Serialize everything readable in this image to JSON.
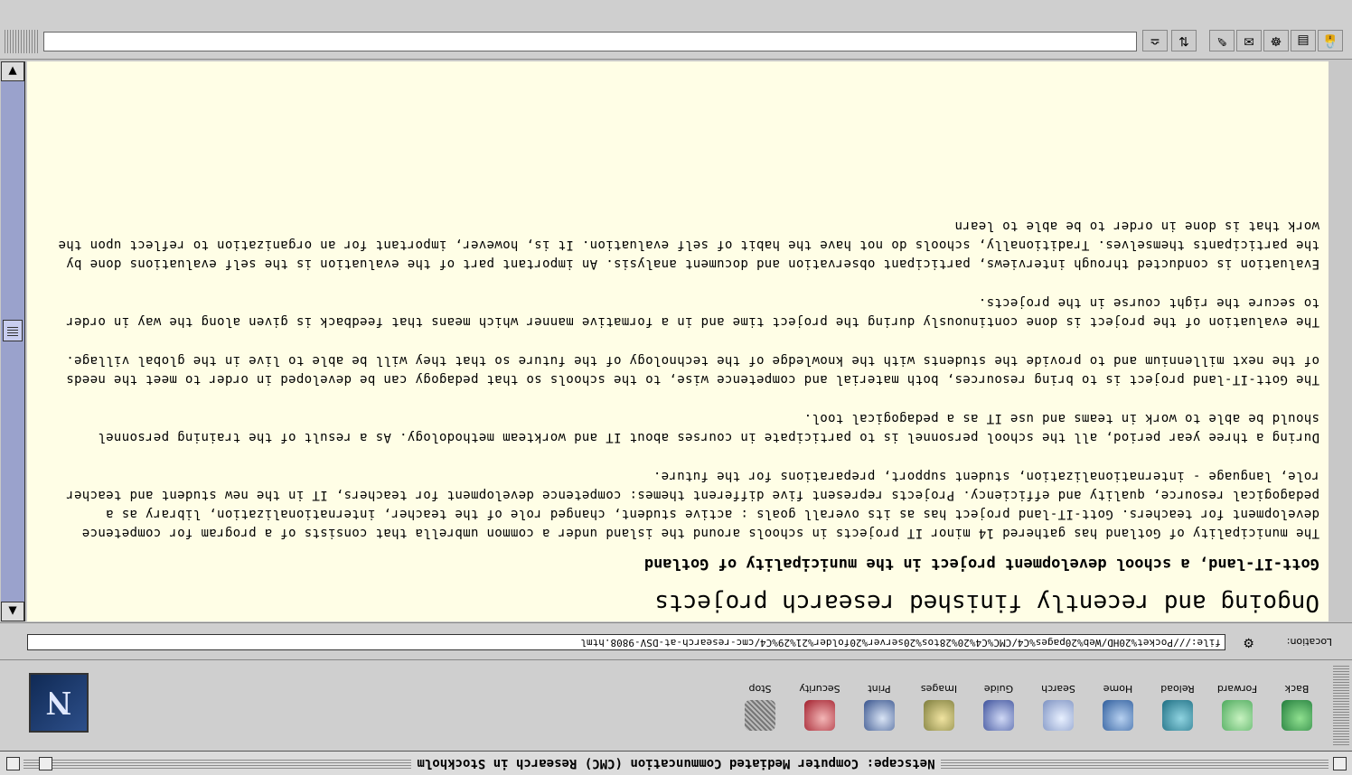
{
  "window": {
    "title": "Netscape: Computer Mediated Communcation (CMC) Research in Stockholm"
  },
  "toolbar": {
    "buttons": [
      {
        "label": "Back",
        "icon": "back-icon"
      },
      {
        "label": "Forward",
        "icon": "forward-icon"
      },
      {
        "label": "Reload",
        "icon": "reload-icon"
      },
      {
        "label": "Home",
        "icon": "home-icon"
      },
      {
        "label": "Search",
        "icon": "search-icon"
      },
      {
        "label": "Guide",
        "icon": "guide-icon"
      },
      {
        "label": "Images",
        "icon": "images-icon"
      },
      {
        "label": "Print",
        "icon": "print-icon"
      },
      {
        "label": "Security",
        "icon": "security-icon"
      },
      {
        "label": "Stop",
        "icon": "stop-icon"
      }
    ],
    "logo": "N"
  },
  "location": {
    "label": "Location:",
    "url": "file:///Pocket%20HD/Web%20pages%C4/CMC%C4%20%28tos%20server%20folder%21%29%C4/cmc-research-at-DSV-9808.html"
  },
  "content": {
    "heading": "Ongoing and recently finished research projects",
    "subheading": "Gott-IT-land, a school development project in the municipality of Gotland",
    "paragraphs": [
      "The municipality of Gotland has gathered 14 minor IT projects in schools around the island under a common umbrella that consists of a program for competence development for teachers. Gott-IT-land project has as its overall goals : active student, changed role of the teacher, internationalization, library as a pedagogical resource, quality and efficiency. Projects represent five different themes: competence development for teachers, IT in the new student and teacher role, language - internationalization, student support, preparations for the future.",
      "During a three year period, all the school personnel is to participate in courses about IT and workteam methodology. As a result of the training personnel should be able to work in teams and use IT as a pedagogical tool.",
      "The Gott-IT-land project is to bring resources, both material and competence wise, to the schools so that pedagogy can be developed in order to meet the needs of the next millennium and to provide the students with the knowledge of the technology of the future so that they will be able to live in the global village.",
      "The evaluation of the project is done continuously during the project time and in a formative manner which means that feedback is given along the way in order to secure the right course in the projects.",
      "Evaluation is conducted through interviews, participant observation and document analysis. An important part of the evaluation is the self evaluations done by the participants themselves. Traditionally, schools do not have the habit of self evaluation. It is, however, important for an organization to reflect upon the work that is done in order to be able to learn"
    ]
  },
  "colors": {
    "page_background": "#fffee6",
    "scrollbar_track": "#9aa2cc",
    "chrome": "#cfcfcf"
  }
}
